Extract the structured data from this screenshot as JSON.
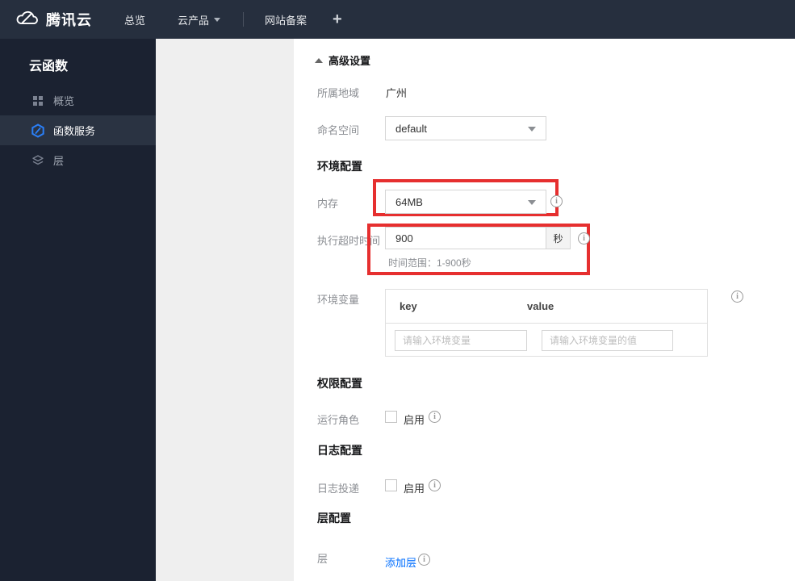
{
  "topnav": {
    "brand": "腾讯云",
    "items": [
      {
        "label": "总览"
      },
      {
        "label": "云产品"
      },
      {
        "label": "网站备案"
      }
    ],
    "plus_label": "+"
  },
  "sidebar": {
    "title": "云函数",
    "items": [
      {
        "label": "概览",
        "icon": "grid-icon",
        "active": false
      },
      {
        "label": "函数服务",
        "icon": "scf-hexagon-icon",
        "active": true
      },
      {
        "label": "层",
        "icon": "layers-icon",
        "active": false
      }
    ]
  },
  "form": {
    "advanced_settings_label": "高级设置",
    "region": {
      "label": "所属地域",
      "value": "广州"
    },
    "namespace": {
      "label": "命名空间",
      "value": "default"
    },
    "section_env": "环境配置",
    "memory": {
      "label": "内存",
      "value": "64MB"
    },
    "timeout": {
      "label": "执行超时时间",
      "value": "900",
      "unit": "秒",
      "hint": "时间范围：1-900秒"
    },
    "env_vars": {
      "label": "环境变量",
      "key_header": "key",
      "value_header": "value",
      "key_placeholder": "请输入环境变量",
      "value_placeholder": "请输入环境变量的值"
    },
    "section_perm": "权限配置",
    "run_role": {
      "label": "运行角色",
      "checkbox_label": "启用"
    },
    "section_log": "日志配置",
    "log_delivery": {
      "label": "日志投递",
      "checkbox_label": "启用"
    },
    "section_layer": "层配置",
    "layer": {
      "label": "层",
      "link_label": "添加层"
    }
  },
  "colors": {
    "accent_blue": "#006eff",
    "highlight_red": "#e62f2f",
    "topnav_bg": "#262f3e",
    "sidebar_bg": "#1b2231"
  }
}
